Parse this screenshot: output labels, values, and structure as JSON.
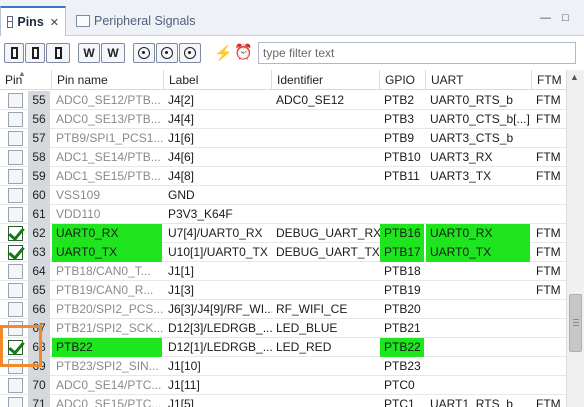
{
  "tabs": {
    "active": {
      "label": "Pins"
    },
    "inactive": {
      "label": "Peripheral Signals"
    }
  },
  "window_buttons": {
    "minimize": "—",
    "maximize": "□"
  },
  "toolbar": {
    "buttons": [
      {
        "name": "show-pins-button"
      },
      {
        "name": "show-pins-alt-button"
      },
      {
        "name": "show-pins-alt2-button"
      },
      {
        "name": "route-button"
      },
      {
        "name": "route-alt-button"
      },
      {
        "name": "expand-button"
      },
      {
        "name": "collapse-button"
      },
      {
        "name": "refresh-button"
      }
    ],
    "filter": {
      "value": "",
      "placeholder": "type filter text"
    }
  },
  "columns": {
    "pin": "Pin",
    "pin_name": "Pin name",
    "label": "Label",
    "identifier": "Identifier",
    "gpio": "GPIO",
    "uart": "UART",
    "ftm": "FTM"
  },
  "rows": [
    {
      "checked": false,
      "pin": "55",
      "pin_name": "ADC0_SE12/PTB...",
      "label": "J4[2]",
      "identifier": "ADC0_SE12",
      "gpio": "PTB2",
      "uart": "UART0_RTS_b",
      "ftm": "FTM",
      "highlight": false
    },
    {
      "checked": false,
      "pin": "56",
      "pin_name": "ADC0_SE13/PTB...",
      "label": "J4[4]",
      "identifier": "",
      "gpio": "PTB3",
      "uart": "UART0_CTS_b[...]",
      "ftm": "FTM",
      "highlight": false
    },
    {
      "checked": false,
      "pin": "57",
      "pin_name": "PTB9/SPI1_PCS1...",
      "label": "J1[6]",
      "identifier": "",
      "gpio": "PTB9",
      "uart": "UART3_CTS_b",
      "ftm": "",
      "highlight": false
    },
    {
      "checked": false,
      "pin": "58",
      "pin_name": "ADC1_SE14/PTB...",
      "label": "J4[6]",
      "identifier": "",
      "gpio": "PTB10",
      "uart": "UART3_RX",
      "ftm": "FTM",
      "highlight": false
    },
    {
      "checked": false,
      "pin": "59",
      "pin_name": "ADC1_SE15/PTB...",
      "label": "J4[8]",
      "identifier": "",
      "gpio": "PTB11",
      "uart": "UART3_TX",
      "ftm": "FTM",
      "highlight": false
    },
    {
      "checked": false,
      "pin": "60",
      "pin_name": "VSS109",
      "label": "GND",
      "identifier": "",
      "gpio": "",
      "uart": "",
      "ftm": "",
      "highlight": false
    },
    {
      "checked": false,
      "pin": "61",
      "pin_name": "VDD110",
      "label": "P3V3_K64F",
      "identifier": "",
      "gpio": "",
      "uart": "",
      "ftm": "",
      "highlight": false
    },
    {
      "checked": true,
      "pin": "62",
      "pin_name": "UART0_RX",
      "label": "U7[4]/UART0_RX",
      "identifier": "DEBUG_UART_RX",
      "gpio": "PTB16",
      "uart": "UART0_RX",
      "ftm": "FTM",
      "highlight": true
    },
    {
      "checked": true,
      "pin": "63",
      "pin_name": "UART0_TX",
      "label": "U10[1]/UART0_TX",
      "identifier": "DEBUG_UART_TX",
      "gpio": "PTB17",
      "uart": "UART0_TX",
      "ftm": "FTM",
      "highlight": true
    },
    {
      "checked": false,
      "pin": "64",
      "pin_name": "PTB18/CAN0_T...",
      "label": "J1[1]",
      "identifier": "",
      "gpio": "PTB18",
      "uart": "",
      "ftm": "FTM",
      "highlight": false
    },
    {
      "checked": false,
      "pin": "65",
      "pin_name": "PTB19/CAN0_R...",
      "label": "J1[3]",
      "identifier": "",
      "gpio": "PTB19",
      "uart": "",
      "ftm": "FTM",
      "highlight": false
    },
    {
      "checked": false,
      "pin": "66",
      "pin_name": "PTB20/SPI2_PCS...",
      "label": "J6[3]/J4[9]/RF_WI...",
      "identifier": "RF_WIFI_CE",
      "gpio": "PTB20",
      "uart": "",
      "ftm": "",
      "highlight": false
    },
    {
      "checked": false,
      "pin": "67",
      "pin_name": "PTB21/SPI2_SCK...",
      "label": "D12[3]/LEDRGB_...",
      "identifier": "LED_BLUE",
      "gpio": "PTB21",
      "uart": "",
      "ftm": "",
      "highlight": false
    },
    {
      "checked": true,
      "pin": "68",
      "pin_name": "PTB22",
      "label": "D12[1]/LEDRGB_...",
      "identifier": "LED_RED",
      "gpio": "PTB22",
      "uart": "",
      "ftm": "",
      "highlight": true
    },
    {
      "checked": false,
      "pin": "69",
      "pin_name": "PTB23/SPI2_SIN...",
      "label": "J1[10]",
      "identifier": "",
      "gpio": "PTB23",
      "uart": "",
      "ftm": "",
      "highlight": false
    },
    {
      "checked": false,
      "pin": "70",
      "pin_name": "ADC0_SE14/PTC...",
      "label": "J1[11]",
      "identifier": "",
      "gpio": "PTC0",
      "uart": "",
      "ftm": "",
      "highlight": false
    },
    {
      "checked": false,
      "pin": "71",
      "pin_name": "ADC0_SE15/PTC...",
      "label": "J1[5]",
      "identifier": "",
      "gpio": "PTC1",
      "uart": "UART1_RTS_b",
      "ftm": "FTM",
      "highlight": false
    }
  ],
  "colors": {
    "route_green": "#1fe51f",
    "callout_orange": "#f28a2b",
    "tab_accent": "#3b76c8"
  }
}
